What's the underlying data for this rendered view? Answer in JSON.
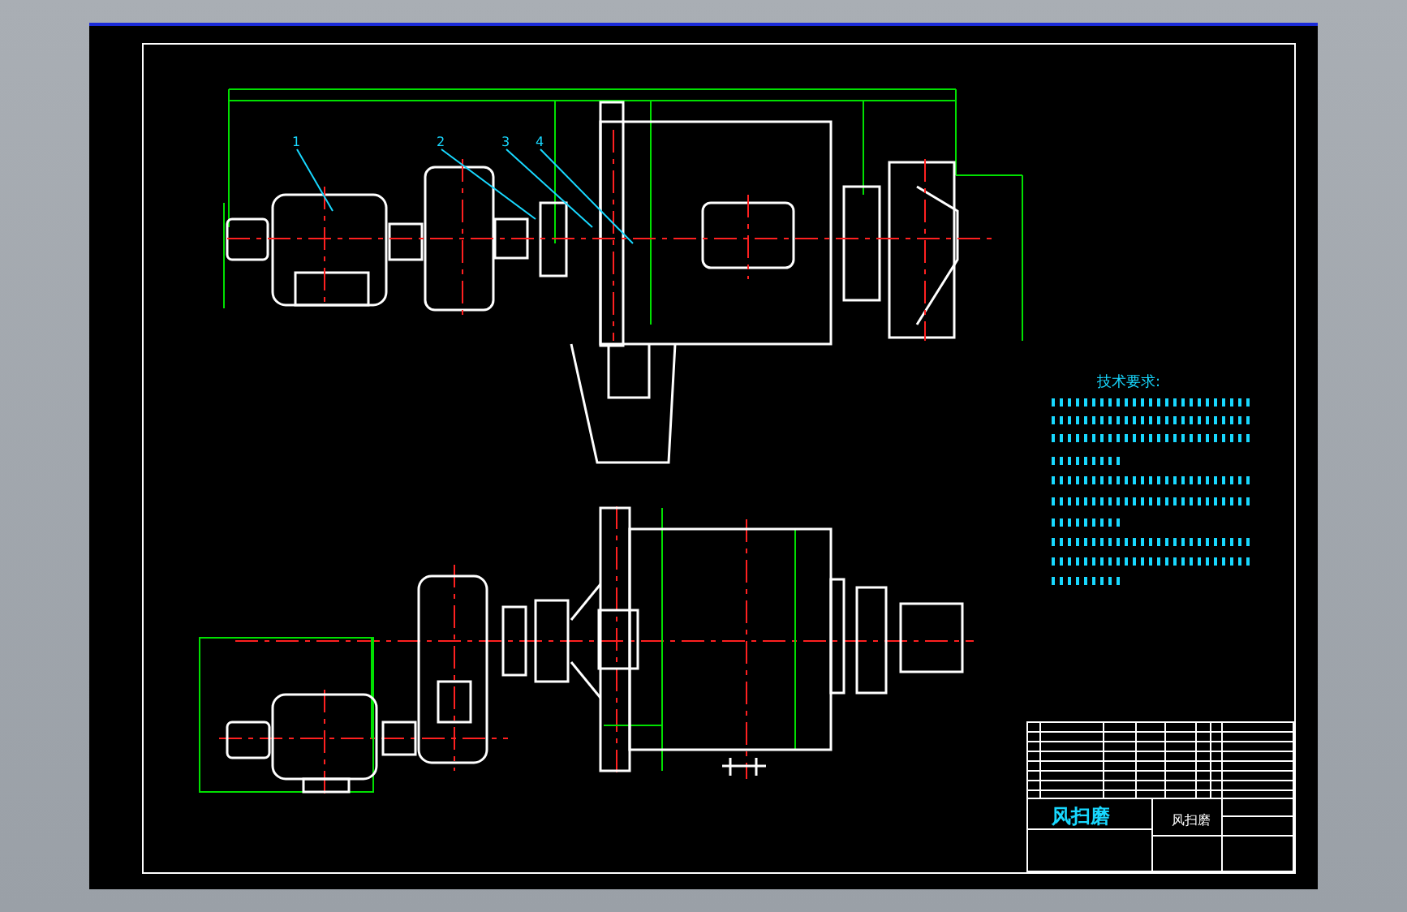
{
  "drawing": {
    "callouts": [
      {
        "label": "1"
      },
      {
        "label": "2"
      },
      {
        "label": "3"
      },
      {
        "label": "4"
      }
    ],
    "notes": {
      "heading": "技术要求:"
    },
    "title_block": {
      "name": "风扫磨",
      "drawing_name": "风扫磨"
    }
  }
}
